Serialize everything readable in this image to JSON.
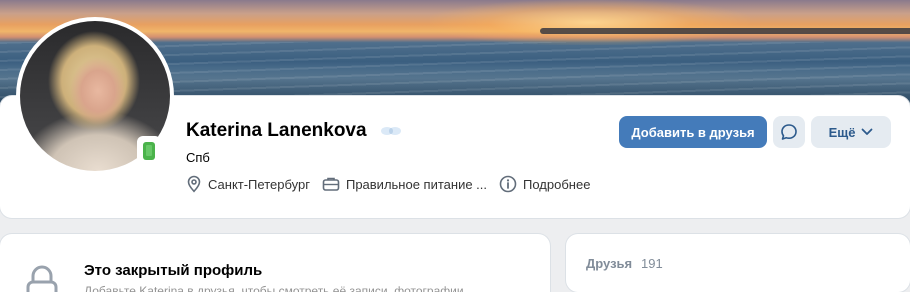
{
  "profile": {
    "name": "Katerina Lanenkova",
    "status": "Спб",
    "info": {
      "city": "Санкт-Петербург",
      "work": "Правильное питание ...",
      "more": "Подробнее"
    },
    "online_device": "mobile"
  },
  "actions": {
    "add_friend_label": "Добавить в друзья",
    "more_label": "Ещё"
  },
  "private_profile": {
    "title": "Это закрытый профиль",
    "subtitle": "Добавьте Katerina в друзья, чтобы смотреть её записи, фотографии"
  },
  "friends": {
    "label": "Друзья",
    "count": "191"
  },
  "colors": {
    "accent": "#447bba",
    "secondary_button_bg": "#e5ebf1",
    "online_green": "#4bb34b",
    "muted_text": "#818c99"
  },
  "icons": [
    "location-icon",
    "briefcase-icon",
    "info-icon",
    "message-icon",
    "chevron-down-icon",
    "lock-icon",
    "mobile-online-icon"
  ]
}
